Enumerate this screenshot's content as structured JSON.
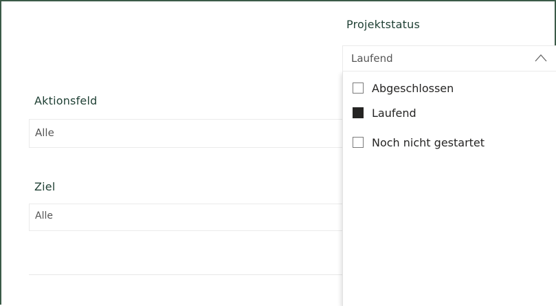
{
  "slicers": {
    "projektstatus": {
      "title": "Projektstatus",
      "selected": "Laufend",
      "options": [
        {
          "label": "Abgeschlossen",
          "checked": false
        },
        {
          "label": "Laufend",
          "checked": true
        },
        {
          "label": "Noch nicht gestartet",
          "checked": false
        }
      ]
    },
    "aktionsfeld": {
      "title": "Aktionsfeld",
      "selected": "Alle"
    },
    "ziel": {
      "title": "Ziel",
      "selected": "Alle"
    }
  },
  "colors": {
    "title": "#1e3f33",
    "frame": "#3b5a47",
    "checkbox_checked": "#252423"
  },
  "icons": {
    "dropdown_toggle": "chevron-up-icon"
  }
}
